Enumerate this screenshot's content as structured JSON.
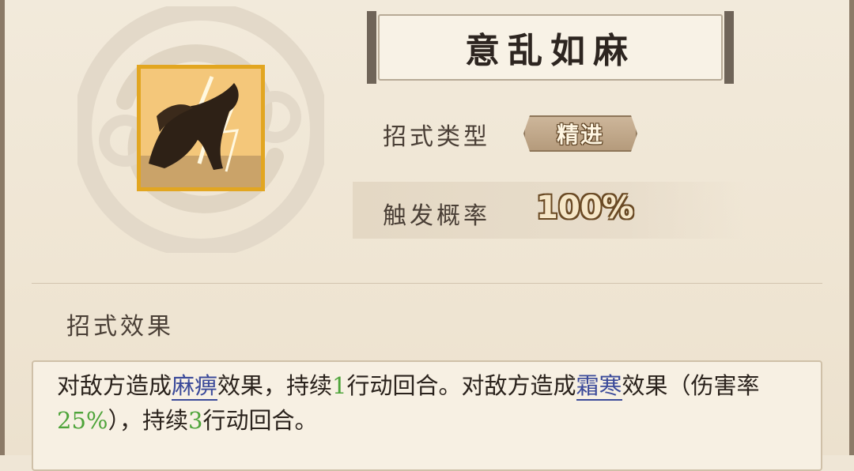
{
  "skill": {
    "title": "意乱如麻",
    "type_label": "招式类型",
    "type_value": "精进",
    "rate_label": "触发概率",
    "rate_value": "100%",
    "effect_label": "招式效果",
    "effect": {
      "p1": "对敌方造成",
      "kw1": "麻痹",
      "p2": "效果，持续",
      "n1": "1",
      "p3": "行动回合。对敌方造成",
      "kw2": "霜寒",
      "p4": "效果（伤害率",
      "n2": "25%",
      "p5": "），持续",
      "n3": "3",
      "p6": "行动回合。"
    }
  },
  "colors": {
    "keyword": "#3b4a9a",
    "number": "#4ea43a",
    "icon_border": "#e2a621"
  },
  "icons": {
    "emblem": "cloud-swirl-emblem",
    "skill": "lightning-beast-icon"
  }
}
